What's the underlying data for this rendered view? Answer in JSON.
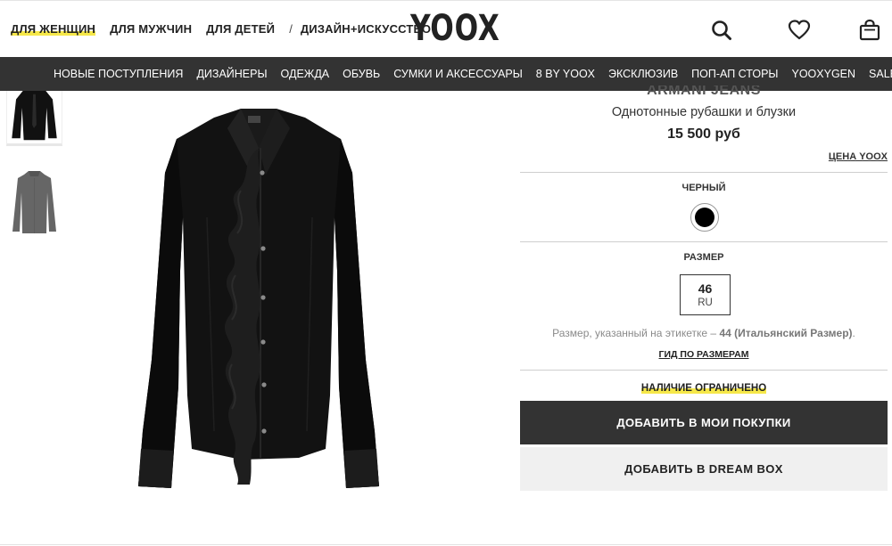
{
  "header": {
    "gender_nav": [
      {
        "label": "ДЛЯ ЖЕНЩИН",
        "active": true
      },
      {
        "label": "ДЛЯ МУЖЧИН",
        "active": false
      },
      {
        "label": "ДЛЯ ДЕТЕЙ",
        "active": false
      }
    ],
    "separator": "/",
    "art_link": "ДИЗАЙН+ИСКУССТВО",
    "logo": "YOOX",
    "icons": [
      "search-icon",
      "heart-icon",
      "shopping-bag-icon"
    ]
  },
  "category_nav": [
    "НОВЫЕ ПОСТУПЛЕНИЯ",
    "ДИЗАЙНЕРЫ",
    "ОДЕЖДА",
    "ОБУВЬ",
    "СУМКИ И АКСЕССУАРЫ",
    "8 BY YOOX",
    "ЭКСКЛЮЗИВ",
    "ПОП-АП СТОРЫ",
    "YOOXYGEN",
    "SALE"
  ],
  "product": {
    "brand": "ARMANI JEANS",
    "category": "Однотонные рубашки и блузки",
    "price": "15 500 руб",
    "price_link": "ЦЕНА YOOX",
    "color_label": "ЧЕРНЫЙ",
    "color_hex": "#000000",
    "size_label": "РАЗМЕР",
    "size_value": "46",
    "size_unit": "RU",
    "size_note_prefix": "Размер, указанный на этикетке – ",
    "size_note_bold": "44 (Итальянский Размер)",
    "size_note_suffix": ".",
    "size_guide": "ГИД ПО РАЗМЕРАМ",
    "stock": "НАЛИЧИЕ ОГРАНИЧЕНО",
    "add_to_cart": "ДОБАВИТЬ В МОИ ПОКУПКИ",
    "add_to_dreambox": "ДОБАВИТЬ В DREAM BOX"
  },
  "colors": {
    "nav_bar": "#333333",
    "highlight": "#f6e84a",
    "buy_button": "#333333",
    "dream_button": "#f0f0f0"
  }
}
